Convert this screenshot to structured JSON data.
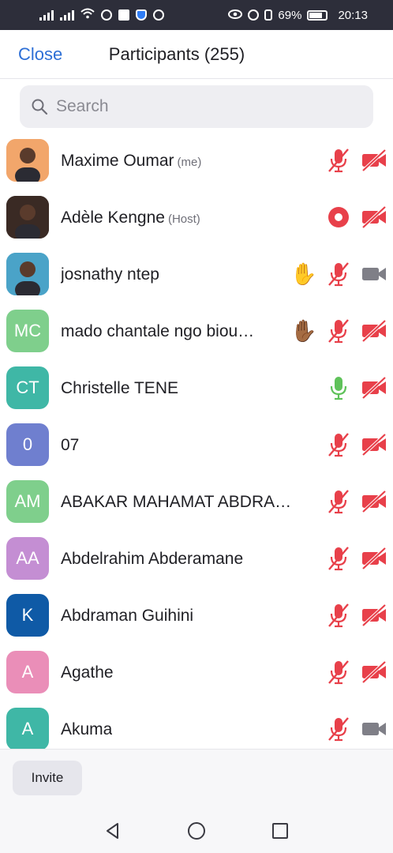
{
  "status_bar": {
    "battery": "69%",
    "time": "20:13"
  },
  "header": {
    "close_label": "Close",
    "title": "Participants (255)"
  },
  "search": {
    "placeholder": "Search"
  },
  "participants": [
    {
      "name": "Maxime Oumar",
      "role": "(me)",
      "avatar": "photo",
      "avatar_color": "#f2a66b",
      "hand": "",
      "mic": "muted",
      "cam": "off"
    },
    {
      "name": "Adèle Kengne",
      "role": "(Host)",
      "avatar": "photo",
      "avatar_color": "#3a2a24",
      "hand": "",
      "mic": "recording",
      "cam": "off"
    },
    {
      "name": "josnathy ntep",
      "role": "",
      "avatar": "photo",
      "avatar_color": "#4aa3c8",
      "hand": "✋",
      "mic": "muted",
      "cam": "off-gray"
    },
    {
      "name": "mado chantale ngo biou…",
      "role": "",
      "avatar": "MC",
      "avatar_color": "#7fcf8c",
      "hand": "✋🏾",
      "mic": "muted",
      "cam": "off"
    },
    {
      "name": "Christelle TENE",
      "role": "",
      "avatar": "CT",
      "avatar_color": "#3fb7a6",
      "hand": "",
      "mic": "on",
      "cam": "off"
    },
    {
      "name": "07",
      "role": "",
      "avatar": "0",
      "avatar_color": "#6f7fcf",
      "hand": "",
      "mic": "muted",
      "cam": "off"
    },
    {
      "name": "ABAKAR MAHAMAT ABDRA…",
      "role": "",
      "avatar": "AM",
      "avatar_color": "#7fcf8c",
      "hand": "",
      "mic": "muted",
      "cam": "off"
    },
    {
      "name": "Abdelrahim Abderamane",
      "role": "",
      "avatar": "AA",
      "avatar_color": "#c48ed3",
      "hand": "",
      "mic": "muted",
      "cam": "off"
    },
    {
      "name": "Abdraman Guihini",
      "role": "",
      "avatar": "K",
      "avatar_color": "#0f5aa6",
      "hand": "",
      "mic": "muted",
      "cam": "off"
    },
    {
      "name": "Agathe",
      "role": "",
      "avatar": "A",
      "avatar_color": "#ea8eb8",
      "hand": "",
      "mic": "muted",
      "cam": "off"
    },
    {
      "name": "Akuma",
      "role": "",
      "avatar": "A",
      "avatar_color": "#3fb7a6",
      "hand": "",
      "mic": "muted",
      "cam": "off-gray"
    }
  ],
  "footer": {
    "invite_label": "Invite"
  },
  "colors": {
    "accent": "#2d6fd6",
    "muted_red": "#e8404a",
    "mic_on_green": "#5fc25a",
    "cam_gray": "#7f7f87"
  }
}
